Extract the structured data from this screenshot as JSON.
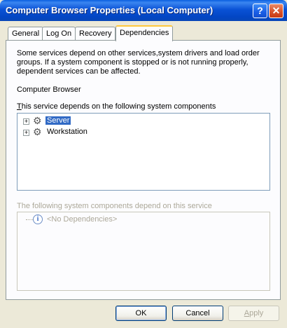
{
  "window": {
    "title": "Computer Browser Properties (Local Computer)",
    "help_symbol": "?",
    "close_symbol": "✕"
  },
  "tabs": [
    {
      "label": "General"
    },
    {
      "label": "Log On"
    },
    {
      "label": "Recovery"
    },
    {
      "label": "Dependencies"
    }
  ],
  "panel": {
    "description": "Some services depend on other services,system drivers and load order groups. If a system component is stopped or is not running properly, dependent services can be affected.",
    "service_name": "Computer Browser",
    "depends_on_label_first": "T",
    "depends_on_label_rest": "his service depends on the following system components",
    "depends_on_items": [
      {
        "label": "Server",
        "expander": "+",
        "selected": true
      },
      {
        "label": "Workstation",
        "expander": "+",
        "selected": false
      }
    ],
    "dependents_label": "The following system components depend on this service",
    "dependents_items": [
      {
        "label": "<No Dependencies>"
      }
    ]
  },
  "buttons": {
    "ok": "OK",
    "cancel": "Cancel",
    "apply_first": "A",
    "apply_rest": "pply"
  },
  "colors": {
    "selection": "#316AC5",
    "titlebar": "#0A52D6",
    "active_tab_accent": "#FFC83C"
  }
}
